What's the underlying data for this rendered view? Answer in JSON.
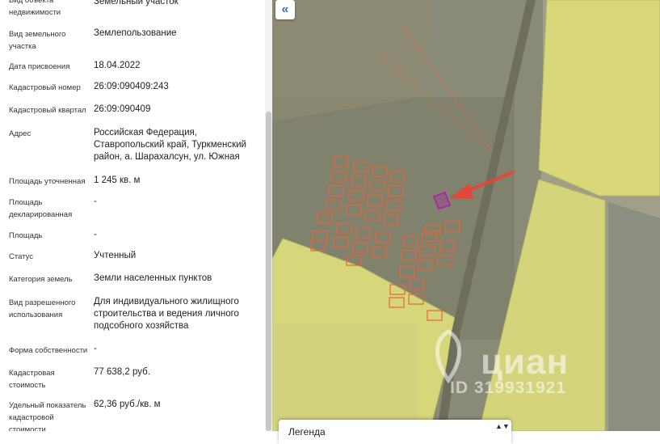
{
  "fields": [
    {
      "label": "Вид объекта недвижимости",
      "value": "Земельный участок"
    },
    {
      "label": "Вид земельного участка",
      "value": "Землепользование"
    },
    {
      "label": "Дата присвоения",
      "value": "18.04.2022"
    },
    {
      "label": "Кадастровый номер",
      "value": "26:09:090409:243"
    },
    {
      "label": "Кадастровый квартал",
      "value": "26:09:090409"
    },
    {
      "label": "Адрес",
      "value": "Российская Федерация, Ставропольский край, Туркменский район, а. Шарахалсун, ул. Южная"
    },
    {
      "label": "Площадь уточненная",
      "value": "1 245 кв. м"
    },
    {
      "label": "Площадь декларированная",
      "value": "-"
    },
    {
      "label": "Площадь",
      "value": "-"
    },
    {
      "label": "Статус",
      "value": "Учтенный"
    },
    {
      "label": "Категория земель",
      "value": "Земли населенных пунктов"
    },
    {
      "label": "Вид разрешенного использования",
      "value": "Для индивидуального жилищного строительства и ведения личного подсобного хозяйства"
    },
    {
      "label": "Форма собственности",
      "value": "-"
    },
    {
      "label": "Кадастровая стоимость",
      "value": "77 638,2 руб."
    },
    {
      "label": "Удельный показатель кадастровой стоимости",
      "value": "62,36 руб./кв. м"
    }
  ],
  "map": {
    "collapse_icon": "«",
    "legend_title": "Легенда",
    "legend_arrows": "▲▼",
    "watermark_logo": "циан",
    "watermark_id": "ID 319931921"
  },
  "colors": {
    "parcel_outline": "#e8643a",
    "selected_parcel": "#b01fa8",
    "field_fill": "#d8d87a",
    "arrow": "#e0483a",
    "link_blue": "#3a6fb0"
  }
}
